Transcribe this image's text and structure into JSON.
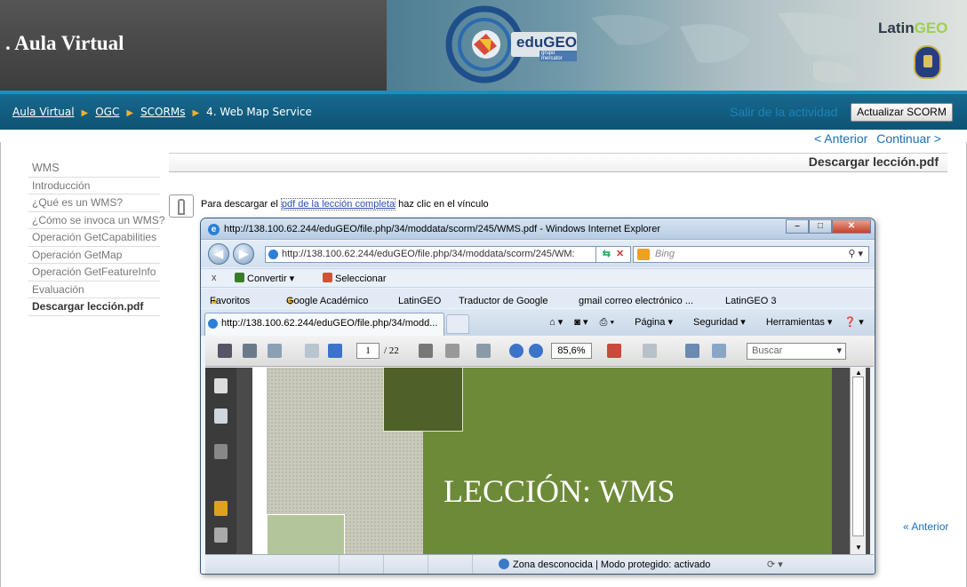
{
  "header": {
    "site_title": ". Aula Virtual",
    "edugeo": "eduGEO",
    "edugeo_sub": "grupo mercator",
    "latin": "Latin",
    "latin_tail": "GEO"
  },
  "nav": {
    "crumbs": [
      "Aula Virtual",
      "OGC",
      "SCORMs",
      "4. Web Map Service"
    ],
    "exit_link": "Salir de la actividad",
    "update_button": "Actualizar SCORM"
  },
  "pager": {
    "prev": "< Anterior",
    "next": "Continuar >"
  },
  "sidebar": {
    "items": [
      "WMS",
      "Introducción",
      "¿Qué es un WMS?",
      "¿Cómo se invoca un WMS?",
      "Operación GetCapabilities",
      "Operación GetMap",
      "Operación GetFeatureInfo",
      "Evaluación",
      "Descargar lección.pdf"
    ]
  },
  "content": {
    "title": "Descargar lección.pdf",
    "prefix": "Para descargar el ",
    "link": "pdf de la lección completa",
    "suffix": " haz clic en el vínculo",
    "anterior": "« Anterior"
  },
  "ie": {
    "title": "http://138.100.62.244/eduGEO/file.php/34/moddata/scorm/245/WMS.pdf - Windows Internet Explorer",
    "address": "http://138.100.62.244/eduGEO/file.php/34/moddata/scorm/245/WM:",
    "search_placeholder": "Bing",
    "convertir": "Convertir",
    "seleccionar": "Seleccionar",
    "favorites": [
      "Favoritos",
      "Google Académico",
      "LatinGEO",
      "Traductor de Google",
      "gmail correo electrónico ...",
      "LatinGEO 3"
    ],
    "tab_label": "http://138.100.62.244/eduGEO/file.php/34/modd...",
    "commands": [
      "Página",
      "Seguridad",
      "Herramientas"
    ],
    "page_current": "1",
    "page_total": "/ 22",
    "zoom": "85,6%",
    "pdf_search": "Buscar",
    "pdf_heading": "LECCIÓN: WMS",
    "status": "Zona desconocida | Modo protegido: activado"
  },
  "colors": {
    "nav_bg": "#0e5375",
    "link": "#1c6fb5",
    "pdf_green": "#6d8a38",
    "accent": "#f0b030"
  }
}
